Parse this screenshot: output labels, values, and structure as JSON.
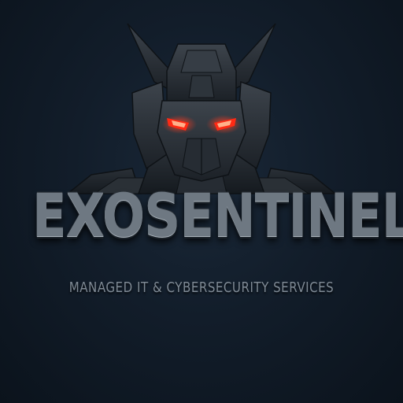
{
  "brand": {
    "name": "EXOSENTINEL",
    "tagline": "MANAGED IT & CYBERSECURITY SERVICES"
  },
  "emblem": {
    "icon": "robot-head-icon",
    "eye_color": "#ff2a14"
  },
  "colors": {
    "background": "#121d2a",
    "armor": "#2b3138",
    "text": "#6e7882"
  }
}
